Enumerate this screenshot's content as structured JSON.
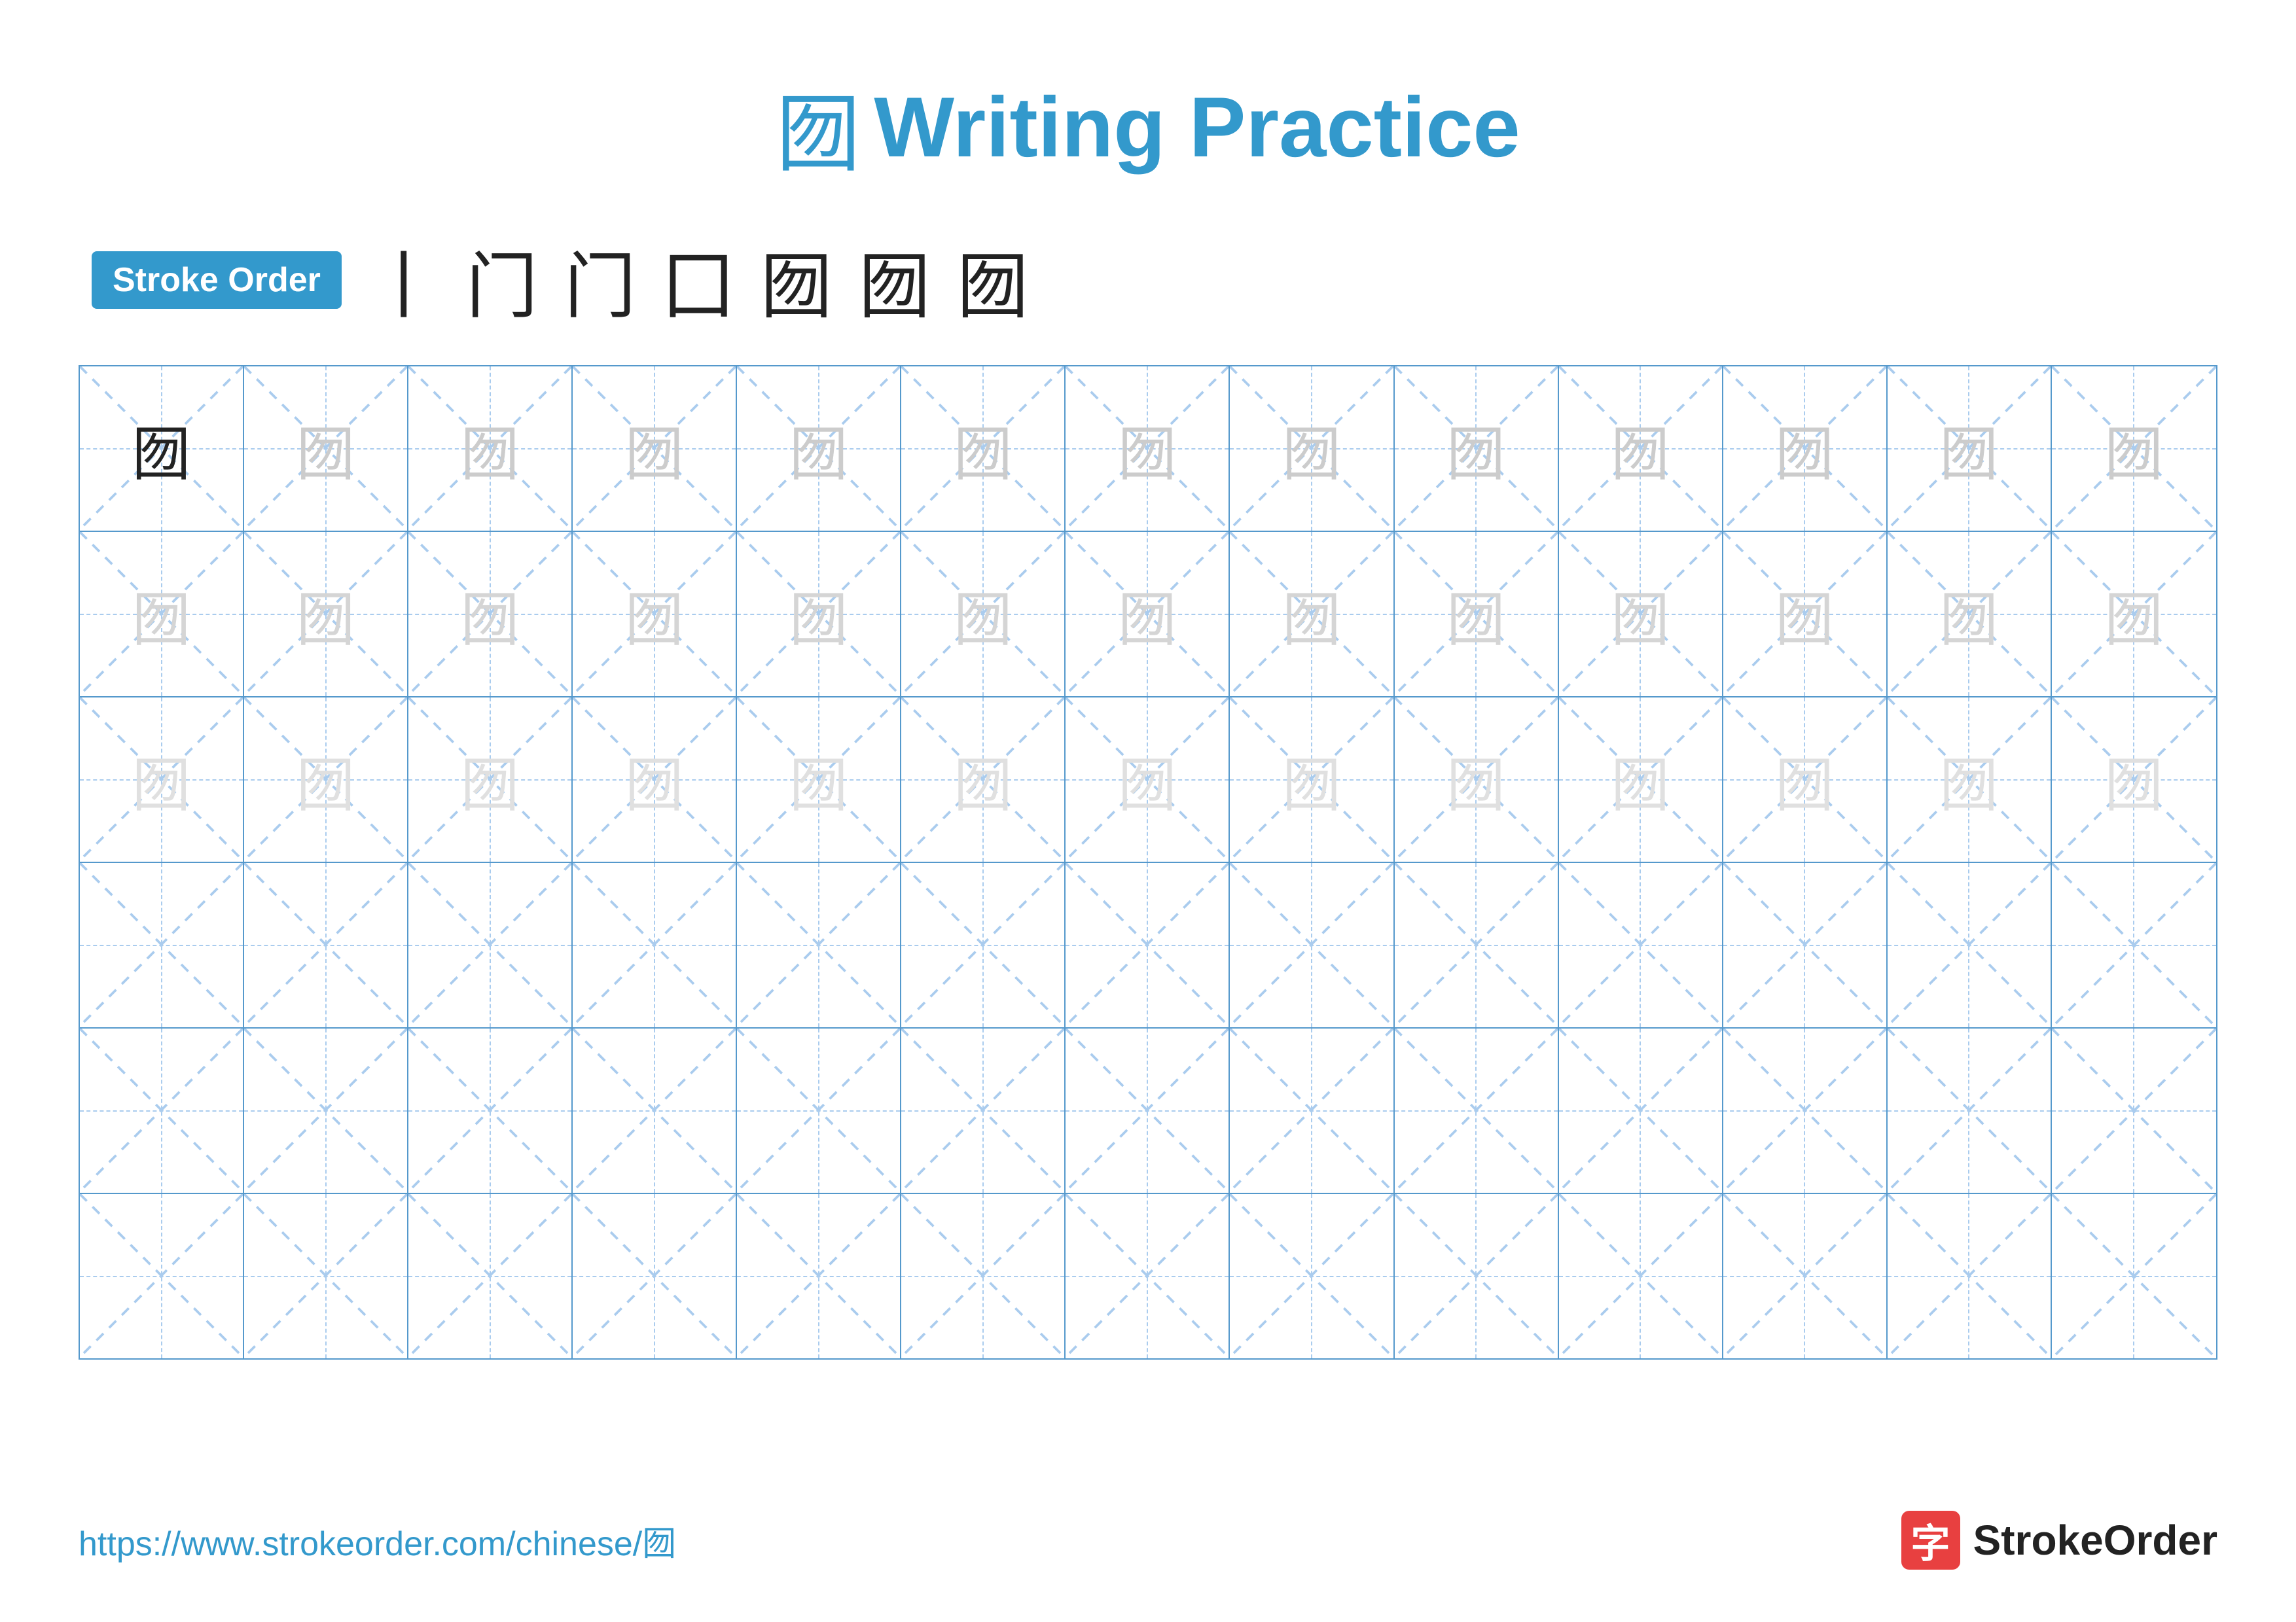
{
  "title": {
    "char": "囫",
    "text": "Writing Practice"
  },
  "stroke_order": {
    "badge_label": "Stroke Order",
    "strokes": [
      "丨",
      "门",
      "门",
      "囗",
      "囫",
      "囫",
      "囫"
    ]
  },
  "grid": {
    "rows": 6,
    "cols": 13,
    "char": "囫",
    "row_data": [
      {
        "type": "solid_then_ghost_dark"
      },
      {
        "type": "ghost_dark"
      },
      {
        "type": "ghost_light"
      },
      {
        "type": "empty"
      },
      {
        "type": "empty"
      },
      {
        "type": "empty"
      }
    ]
  },
  "footer": {
    "url": "https://www.strokeorder.com/chinese/囫",
    "brand_logo_char": "字",
    "brand_name": "StrokeOrder"
  }
}
